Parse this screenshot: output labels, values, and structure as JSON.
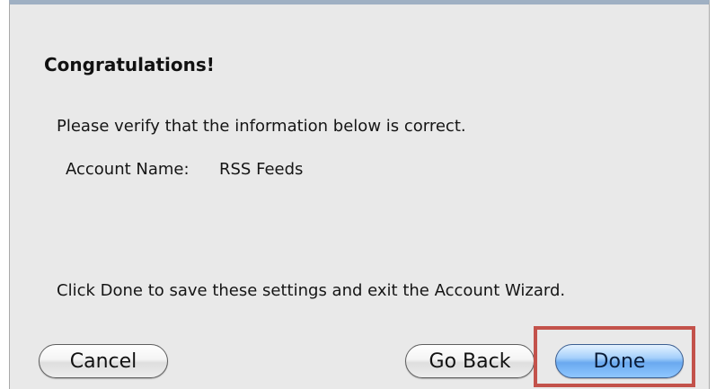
{
  "dialog": {
    "title": "Congratulations!",
    "verify_text": "Please verify that the information below is correct.",
    "account_name_label": "Account Name:",
    "account_name_value": "RSS Feeds",
    "instruction_text": "Click Done to save these settings and exit the Account Wizard."
  },
  "buttons": {
    "cancel": "Cancel",
    "go_back": "Go Back",
    "done": "Done"
  },
  "colors": {
    "highlight": "#c3524b",
    "done_button": "#6aa9ef"
  }
}
